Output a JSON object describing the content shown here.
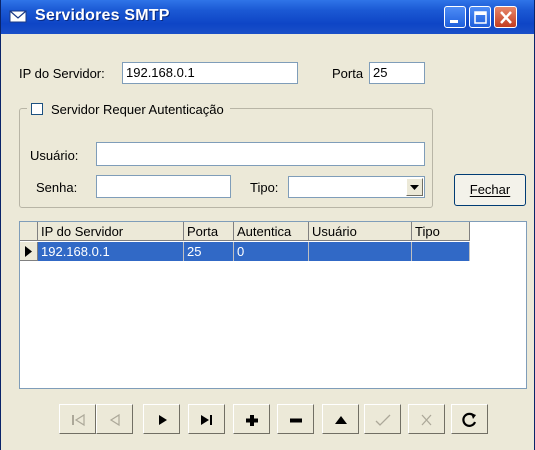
{
  "window": {
    "title": "Servidores SMTP",
    "accent": "#0e45c6"
  },
  "form": {
    "ip_label": "IP do Servidor:",
    "ip_value": "192.168.0.1",
    "port_label": "Porta",
    "port_value": "25",
    "auth_group_label": "Servidor Requer Autenticação",
    "auth_checked": false,
    "user_label": "Usuário:",
    "user_value": "",
    "password_label": "Senha:",
    "password_value": "",
    "type_label": "Tipo:",
    "type_value": "",
    "close_button": "Fechar"
  },
  "grid": {
    "columns": [
      "IP do Servidor",
      "Porta",
      "Autentica",
      "Usuário",
      "Tipo"
    ],
    "rows": [
      [
        "192.168.0.1",
        "25",
        "0",
        "",
        ""
      ]
    ],
    "selected_row_color": "#3169c6"
  },
  "navigator": {
    "buttons": [
      {
        "name": "first-record",
        "icon": "first-icon",
        "enabled": false
      },
      {
        "name": "prior-record",
        "icon": "prior-icon",
        "enabled": false
      },
      {
        "name": "next-record",
        "icon": "next-icon",
        "enabled": true
      },
      {
        "name": "last-record",
        "icon": "last-icon",
        "enabled": true
      },
      {
        "name": "insert-record",
        "icon": "plus-icon",
        "enabled": true
      },
      {
        "name": "delete-record",
        "icon": "minus-icon",
        "enabled": true
      },
      {
        "name": "edit-record",
        "icon": "up-triangle-icon",
        "enabled": true
      },
      {
        "name": "post-record",
        "icon": "check-icon",
        "enabled": false
      },
      {
        "name": "cancel-record",
        "icon": "x-icon",
        "enabled": false
      },
      {
        "name": "refresh-record",
        "icon": "refresh-icon",
        "enabled": true
      }
    ]
  }
}
